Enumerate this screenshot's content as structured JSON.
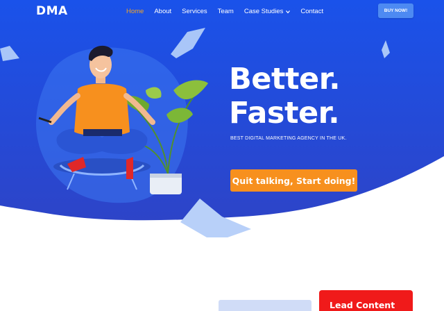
{
  "brand": {
    "logo": "DMA"
  },
  "nav": {
    "items": [
      {
        "label": "Home",
        "active": true
      },
      {
        "label": "About",
        "active": false
      },
      {
        "label": "Services",
        "active": false
      },
      {
        "label": "Team",
        "active": false
      },
      {
        "label": "Case Studies",
        "active": false,
        "dropdown": true
      },
      {
        "label": "Contact",
        "active": false
      }
    ],
    "buy_label": "BUY NOW!"
  },
  "hero": {
    "headline_line1": "Better.",
    "headline_line2": "Faster.",
    "tagline": "BEST DIGITAL MARKETING AGENCY IN THE UK.",
    "cta_label": "Quit talking, Start doing!"
  },
  "lower": {
    "lead_title": "Lead Content"
  },
  "colors": {
    "hero_blue": "#1f55e6",
    "accent_orange": "#f7901e",
    "nav_active": "#f5a623",
    "buy_button": "#4d8af2",
    "lead_red": "#f01a1a"
  },
  "icons": [
    "chevron-down-icon",
    "meditating-man-illustration",
    "potted-plant-illustration",
    "paper-sheet-icon"
  ]
}
